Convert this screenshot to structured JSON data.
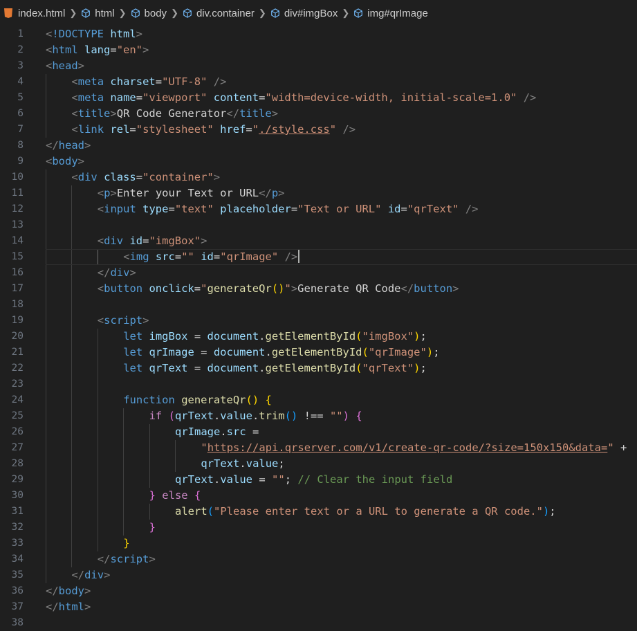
{
  "breadcrumb": {
    "file": "index.html",
    "items": [
      "html",
      "body",
      "div.container",
      "div#imgBox",
      "img#qrImage"
    ]
  },
  "colors": {
    "background": "#1f1f1f",
    "html_icon": "#e37933",
    "tag": "#569cd6",
    "attribute": "#9cdcfe",
    "string": "#ce9178",
    "comment": "#6a9955",
    "function": "#dcdcaa"
  },
  "editor": {
    "current_line": 15,
    "lines": [
      {
        "n": 1,
        "indent": 0,
        "tokens": [
          [
            "p",
            "<"
          ],
          [
            "t",
            "!DOCTYPE "
          ],
          [
            "a",
            "html"
          ],
          [
            "p",
            ">"
          ]
        ]
      },
      {
        "n": 2,
        "indent": 0,
        "tokens": [
          [
            "p",
            "<"
          ],
          [
            "t",
            "html "
          ],
          [
            "a",
            "lang"
          ],
          [
            "w",
            "="
          ],
          [
            "s",
            "\"en\""
          ],
          [
            "p",
            ">"
          ]
        ]
      },
      {
        "n": 3,
        "indent": 0,
        "tokens": [
          [
            "p",
            "<"
          ],
          [
            "t",
            "head"
          ],
          [
            "p",
            ">"
          ]
        ]
      },
      {
        "n": 4,
        "indent": 1,
        "tokens": [
          [
            "p",
            "<"
          ],
          [
            "t",
            "meta "
          ],
          [
            "a",
            "charset"
          ],
          [
            "w",
            "="
          ],
          [
            "s",
            "\"UTF-8\""
          ],
          [
            "p",
            " />"
          ]
        ]
      },
      {
        "n": 5,
        "indent": 1,
        "tokens": [
          [
            "p",
            "<"
          ],
          [
            "t",
            "meta "
          ],
          [
            "a",
            "name"
          ],
          [
            "w",
            "="
          ],
          [
            "s",
            "\"viewport\""
          ],
          [
            "w",
            " "
          ],
          [
            "a",
            "content"
          ],
          [
            "w",
            "="
          ],
          [
            "s",
            "\"width=device-width, initial-scale=1.0\""
          ],
          [
            "p",
            " />"
          ]
        ]
      },
      {
        "n": 6,
        "indent": 1,
        "tokens": [
          [
            "p",
            "<"
          ],
          [
            "t",
            "title"
          ],
          [
            "p",
            ">"
          ],
          [
            "w",
            "QR Code Generator"
          ],
          [
            "p",
            "</"
          ],
          [
            "t",
            "title"
          ],
          [
            "p",
            ">"
          ]
        ]
      },
      {
        "n": 7,
        "indent": 1,
        "tokens": [
          [
            "p",
            "<"
          ],
          [
            "t",
            "link "
          ],
          [
            "a",
            "rel"
          ],
          [
            "w",
            "="
          ],
          [
            "s",
            "\"stylesheet\""
          ],
          [
            "w",
            " "
          ],
          [
            "a",
            "href"
          ],
          [
            "w",
            "="
          ],
          [
            "s",
            "\""
          ],
          [
            "su",
            "./style.css"
          ],
          [
            "s",
            "\""
          ],
          [
            "p",
            " />"
          ]
        ]
      },
      {
        "n": 8,
        "indent": 0,
        "tokens": [
          [
            "p",
            "</"
          ],
          [
            "t",
            "head"
          ],
          [
            "p",
            ">"
          ]
        ]
      },
      {
        "n": 9,
        "indent": 0,
        "tokens": [
          [
            "p",
            "<"
          ],
          [
            "t",
            "body"
          ],
          [
            "p",
            ">"
          ]
        ]
      },
      {
        "n": 10,
        "indent": 1,
        "tokens": [
          [
            "p",
            "<"
          ],
          [
            "t",
            "div "
          ],
          [
            "a",
            "class"
          ],
          [
            "w",
            "="
          ],
          [
            "s",
            "\"container\""
          ],
          [
            "p",
            ">"
          ]
        ]
      },
      {
        "n": 11,
        "indent": 2,
        "tokens": [
          [
            "p",
            "<"
          ],
          [
            "t",
            "p"
          ],
          [
            "p",
            ">"
          ],
          [
            "w",
            "Enter your Text or URL"
          ],
          [
            "p",
            "</"
          ],
          [
            "t",
            "p"
          ],
          [
            "p",
            ">"
          ]
        ]
      },
      {
        "n": 12,
        "indent": 2,
        "tokens": [
          [
            "p",
            "<"
          ],
          [
            "t",
            "input "
          ],
          [
            "a",
            "type"
          ],
          [
            "w",
            "="
          ],
          [
            "s",
            "\"text\""
          ],
          [
            "w",
            " "
          ],
          [
            "a",
            "placeholder"
          ],
          [
            "w",
            "="
          ],
          [
            "s",
            "\"Text or URL\""
          ],
          [
            "w",
            " "
          ],
          [
            "a",
            "id"
          ],
          [
            "w",
            "="
          ],
          [
            "s",
            "\"qrText\""
          ],
          [
            "p",
            " />"
          ]
        ]
      },
      {
        "n": 13,
        "indent": 2,
        "tokens": []
      },
      {
        "n": 14,
        "indent": 2,
        "tokens": [
          [
            "p",
            "<"
          ],
          [
            "t",
            "div "
          ],
          [
            "a",
            "id"
          ],
          [
            "w",
            "="
          ],
          [
            "s",
            "\"imgBox\""
          ],
          [
            "p",
            ">"
          ]
        ]
      },
      {
        "n": 15,
        "indent": 3,
        "tokens": [
          [
            "p",
            "<"
          ],
          [
            "t",
            "img "
          ],
          [
            "a",
            "src"
          ],
          [
            "w",
            "="
          ],
          [
            "s",
            "\"\""
          ],
          [
            "w",
            " "
          ],
          [
            "a",
            "id"
          ],
          [
            "w",
            "="
          ],
          [
            "s",
            "\"qrImage\""
          ],
          [
            "p",
            " />"
          ]
        ]
      },
      {
        "n": 16,
        "indent": 2,
        "tokens": [
          [
            "p",
            "</"
          ],
          [
            "t",
            "div"
          ],
          [
            "p",
            ">"
          ]
        ]
      },
      {
        "n": 17,
        "indent": 2,
        "tokens": [
          [
            "p",
            "<"
          ],
          [
            "t",
            "button "
          ],
          [
            "a",
            "onclick"
          ],
          [
            "w",
            "="
          ],
          [
            "s",
            "\""
          ],
          [
            "f",
            "generateQr"
          ],
          [
            "y",
            "()"
          ],
          [
            "s",
            "\""
          ],
          [
            "p",
            ">"
          ],
          [
            "w",
            "Generate QR Code"
          ],
          [
            "p",
            "</"
          ],
          [
            "t",
            "button"
          ],
          [
            "p",
            ">"
          ]
        ]
      },
      {
        "n": 18,
        "indent": 2,
        "tokens": []
      },
      {
        "n": 19,
        "indent": 2,
        "tokens": [
          [
            "p",
            "<"
          ],
          [
            "t",
            "script"
          ],
          [
            "p",
            ">"
          ]
        ]
      },
      {
        "n": 20,
        "indent": 3,
        "tokens": [
          [
            "t",
            "let "
          ],
          [
            "a",
            "imgBox"
          ],
          [
            "w",
            " = "
          ],
          [
            "a",
            "document"
          ],
          [
            "w",
            "."
          ],
          [
            "f",
            "getElementById"
          ],
          [
            "y",
            "("
          ],
          [
            "s",
            "\"imgBox\""
          ],
          [
            "y",
            ")"
          ],
          [
            "w",
            ";"
          ]
        ]
      },
      {
        "n": 21,
        "indent": 3,
        "tokens": [
          [
            "t",
            "let "
          ],
          [
            "a",
            "qrImage"
          ],
          [
            "w",
            " = "
          ],
          [
            "a",
            "document"
          ],
          [
            "w",
            "."
          ],
          [
            "f",
            "getElementById"
          ],
          [
            "y",
            "("
          ],
          [
            "s",
            "\"qrImage\""
          ],
          [
            "y",
            ")"
          ],
          [
            "w",
            ";"
          ]
        ]
      },
      {
        "n": 22,
        "indent": 3,
        "tokens": [
          [
            "t",
            "let "
          ],
          [
            "a",
            "qrText"
          ],
          [
            "w",
            " = "
          ],
          [
            "a",
            "document"
          ],
          [
            "w",
            "."
          ],
          [
            "f",
            "getElementById"
          ],
          [
            "y",
            "("
          ],
          [
            "s",
            "\"qrText\""
          ],
          [
            "y",
            ")"
          ],
          [
            "w",
            ";"
          ]
        ]
      },
      {
        "n": 23,
        "indent": 3,
        "tokens": []
      },
      {
        "n": 24,
        "indent": 3,
        "tokens": [
          [
            "t",
            "function "
          ],
          [
            "f",
            "generateQr"
          ],
          [
            "y",
            "() {"
          ]
        ]
      },
      {
        "n": 25,
        "indent": 4,
        "tokens": [
          [
            "k",
            "if "
          ],
          [
            "m",
            "("
          ],
          [
            "a",
            "qrText"
          ],
          [
            "w",
            "."
          ],
          [
            "a",
            "value"
          ],
          [
            "w",
            "."
          ],
          [
            "f",
            "trim"
          ],
          [
            "b",
            "()"
          ],
          [
            "w",
            " !== "
          ],
          [
            "s",
            "\"\""
          ],
          [
            "m",
            ")"
          ],
          [
            "w",
            " "
          ],
          [
            "m",
            "{"
          ]
        ]
      },
      {
        "n": 26,
        "indent": 5,
        "tokens": [
          [
            "a",
            "qrImage"
          ],
          [
            "w",
            "."
          ],
          [
            "a",
            "src"
          ],
          [
            "w",
            " ="
          ]
        ]
      },
      {
        "n": 27,
        "indent": 6,
        "tokens": [
          [
            "s",
            "\""
          ],
          [
            "su",
            "https://api.qrserver.com/v1/create-qr-code/?size=150x150&data="
          ],
          [
            "s",
            "\""
          ],
          [
            "w",
            " +"
          ]
        ]
      },
      {
        "n": 28,
        "indent": 6,
        "tokens": [
          [
            "a",
            "qrText"
          ],
          [
            "w",
            "."
          ],
          [
            "a",
            "value"
          ],
          [
            "w",
            ";"
          ]
        ]
      },
      {
        "n": 29,
        "indent": 5,
        "tokens": [
          [
            "a",
            "qrText"
          ],
          [
            "w",
            "."
          ],
          [
            "a",
            "value"
          ],
          [
            "w",
            " = "
          ],
          [
            "s",
            "\"\""
          ],
          [
            "w",
            "; "
          ],
          [
            "c",
            "// Clear the input field"
          ]
        ]
      },
      {
        "n": 30,
        "indent": 4,
        "tokens": [
          [
            "m",
            "}"
          ],
          [
            "w",
            " "
          ],
          [
            "k",
            "else "
          ],
          [
            "m",
            "{"
          ]
        ]
      },
      {
        "n": 31,
        "indent": 5,
        "tokens": [
          [
            "f",
            "alert"
          ],
          [
            "b",
            "("
          ],
          [
            "s",
            "\"Please enter text or a URL to generate a QR code.\""
          ],
          [
            "b",
            ")"
          ],
          [
            "w",
            ";"
          ]
        ]
      },
      {
        "n": 32,
        "indent": 4,
        "tokens": [
          [
            "m",
            "}"
          ]
        ]
      },
      {
        "n": 33,
        "indent": 3,
        "tokens": [
          [
            "y",
            "}"
          ]
        ]
      },
      {
        "n": 34,
        "indent": 2,
        "tokens": [
          [
            "p",
            "</"
          ],
          [
            "t",
            "script"
          ],
          [
            "p",
            ">"
          ]
        ]
      },
      {
        "n": 35,
        "indent": 1,
        "tokens": [
          [
            "p",
            "</"
          ],
          [
            "t",
            "div"
          ],
          [
            "p",
            ">"
          ]
        ]
      },
      {
        "n": 36,
        "indent": 0,
        "tokens": [
          [
            "p",
            "</"
          ],
          [
            "t",
            "body"
          ],
          [
            "p",
            ">"
          ]
        ]
      },
      {
        "n": 37,
        "indent": 0,
        "tokens": [
          [
            "p",
            "</"
          ],
          [
            "t",
            "html"
          ],
          [
            "p",
            ">"
          ]
        ]
      },
      {
        "n": 38,
        "indent": 0,
        "tokens": []
      }
    ]
  }
}
